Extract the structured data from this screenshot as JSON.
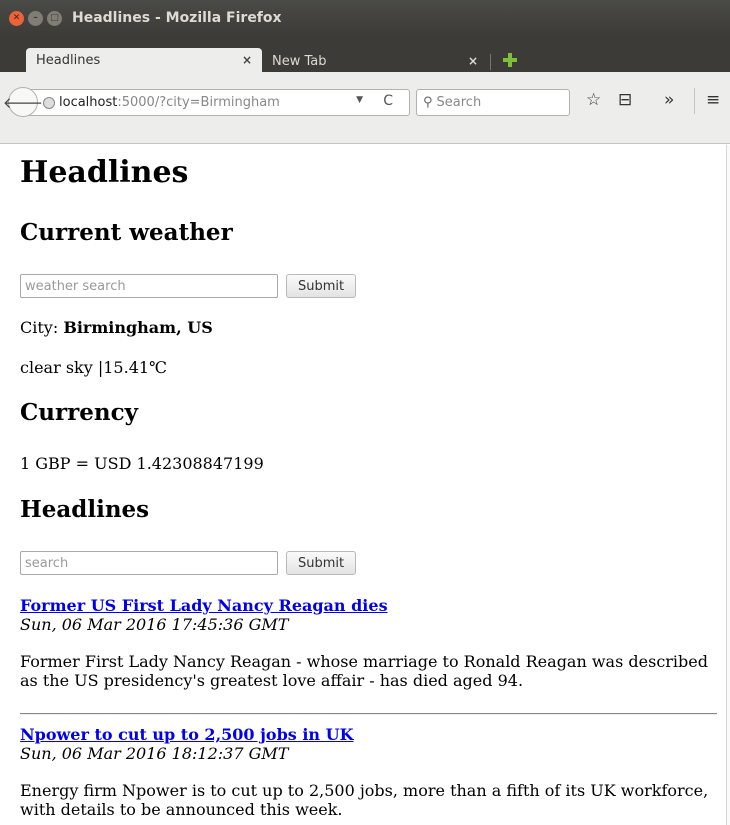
{
  "window": {
    "title": "Headlines - Mozilla Firefox"
  },
  "tabs": [
    {
      "label": "Headlines",
      "close": "×"
    },
    {
      "label": "New Tab",
      "close": "×"
    }
  ],
  "toolbar": {
    "back_icon": "🡐",
    "url_host": "localhost",
    "url_rest": ":5000/?city=Birmingham",
    "url_dropdown": "▼",
    "reload_icon": "C",
    "search_placeholder": "Search",
    "bookmark_icon": "☆",
    "reading_list_icon": "⊟",
    "overflow_icon": "»",
    "menu_icon": "≡"
  },
  "page": {
    "title": "Headlines",
    "weather": {
      "heading": "Current weather",
      "input_placeholder": "weather search",
      "submit_label": "Submit",
      "city_label": "City:",
      "city_value": "Birmingham, US",
      "conditions": "clear sky |15.41℃"
    },
    "currency": {
      "heading": "Currency",
      "rate": "1 GBP = USD 1.42308847199"
    },
    "headlines": {
      "heading": "Headlines",
      "input_placeholder": "search",
      "submit_label": "Submit",
      "articles": [
        {
          "title": "Former US First Lady Nancy Reagan dies",
          "date": "Sun, 06 Mar 2016 17:45:36 GMT",
          "description": "Former First Lady Nancy Reagan - whose marriage to Ronald Reagan was described as the US presidency's greatest love affair - has died aged 94."
        },
        {
          "title": "Npower to cut up to 2,500 jobs in UK",
          "date": "Sun, 06 Mar 2016 18:12:37 GMT",
          "description": "Energy firm Npower is to cut up to 2,500 jobs, more than a fifth of its UK workforce, with details to be announced this week."
        }
      ]
    }
  }
}
